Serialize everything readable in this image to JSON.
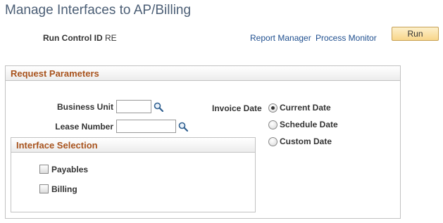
{
  "page": {
    "title": "Manage Interfaces to AP/Billing"
  },
  "run_control": {
    "label": "Run Control ID",
    "value": "RE"
  },
  "links": {
    "report_manager": "Report Manager",
    "process_monitor": "Process Monitor"
  },
  "run_button": {
    "label": "Run"
  },
  "request_parameters": {
    "title": "Request Parameters",
    "business_unit": {
      "label": "Business Unit",
      "value": ""
    },
    "lease_number": {
      "label": "Lease Number",
      "value": ""
    },
    "invoice_date": {
      "label": "Invoice Date",
      "options": [
        {
          "label": "Current Date",
          "selected": true
        },
        {
          "label": "Schedule Date",
          "selected": false
        },
        {
          "label": "Custom Date",
          "selected": false
        }
      ]
    },
    "interface_selection": {
      "title": "Interface Selection",
      "options": [
        {
          "label": "Payables",
          "checked": false
        },
        {
          "label": "Billing",
          "checked": false
        }
      ]
    }
  },
  "icons": {
    "lookup": "magnifier-lookup-icon"
  },
  "colors": {
    "title": "#4b5e75",
    "section_title": "#a8531d",
    "link": "#1f4f8f",
    "button_bg": "#f8d68a"
  }
}
